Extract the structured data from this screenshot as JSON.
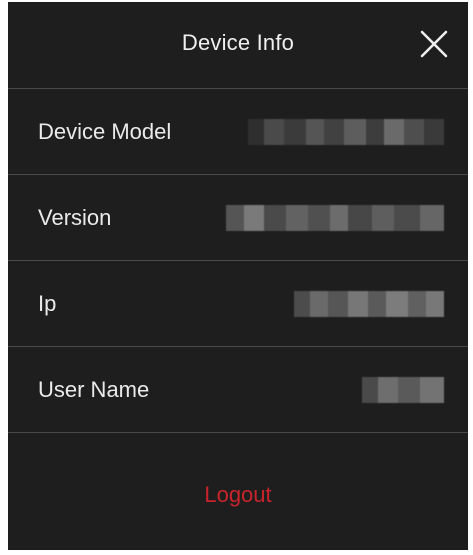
{
  "header": {
    "title": "Device Info",
    "close_icon": "close-icon"
  },
  "rows": [
    {
      "label": "Device Model",
      "value_redacted": true
    },
    {
      "label": "Version",
      "value_redacted": true
    },
    {
      "label": "Ip",
      "value_redacted": true
    },
    {
      "label": "User Name",
      "value_redacted": true
    }
  ],
  "logout": {
    "label": "Logout",
    "color": "#c8242b"
  },
  "colors": {
    "background": "#1e1e1e",
    "divider": "#4a4a4a",
    "text": "#eaeaea",
    "accent": "#c8242b"
  }
}
